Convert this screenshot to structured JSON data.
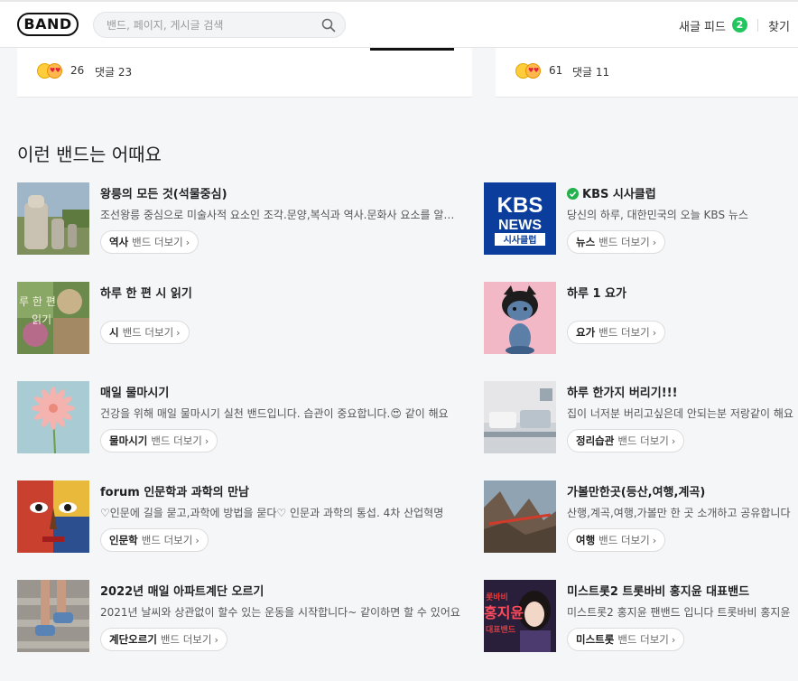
{
  "header": {
    "logo": "BAND",
    "search_placeholder": "밴드, 페이지, 게시글 검색",
    "new_feed_label": "새글 피드",
    "new_feed_count": "2",
    "find_label": "찾기"
  },
  "feed_cards": [
    {
      "reaction_count": "26",
      "comment_label": "댓글 23"
    },
    {
      "reaction_count": "61",
      "comment_label": "댓글 11"
    }
  ],
  "recommend": {
    "title": "이런 밴드는 어때요",
    "more_label": "밴드 더보기",
    "items": [
      {
        "name": "왕릉의 모든 것(석물중심)",
        "desc": "조선왕릉 중심으로 미술사적 요소인 조각.문양,복식과 역사.문화사 요소를 알아봅니다",
        "tag": "역사",
        "thumb": "stone-statue"
      },
      {
        "name": "KBS 시사클럽",
        "verified": true,
        "desc": "당신의 하루, 대한민국의 오늘 KBS 뉴스",
        "tag": "뉴스",
        "thumb": "kbs-logo",
        "thumb_text": [
          "KBS",
          "NEWS",
          "시사클럽"
        ]
      },
      {
        "name": "하루 한 편 시 읽기",
        "desc": "",
        "tag": "시",
        "thumb": "painting-poem",
        "thumb_text": [
          "루 한 편",
          "읽기"
        ]
      },
      {
        "name": "하루 1 요가",
        "desc": "",
        "tag": "요가",
        "thumb": "cartoon-cat"
      },
      {
        "name": "매일 물마시기",
        "desc": "건강을 위해 매일 물마시기 실천 밴드입니다. 습관이 중요합니다.😍 같이 해요",
        "tag": "물마시기",
        "thumb": "pink-flower"
      },
      {
        "name": "하루 한가지 버리기!!!",
        "desc": "집이 너저분 버리고싶은데 안되는분 저랑같이 해요",
        "tag": "정리습관",
        "thumb": "bedroom"
      },
      {
        "name": "forum 인문학과 과학의 만남",
        "desc": "♡인문에 길을 묻고,과학에 방법을 묻다♡ 인문과 과학의 통섭. 4차 산업혁명",
        "tag": "인문학",
        "thumb": "picasso-face"
      },
      {
        "name": "가볼만한곳(등산,여행,계곡)",
        "desc": "산행,계곡,여행,가볼만 한 곳 소개하고 공유합니다",
        "tag": "여행",
        "thumb": "mountain-bridge"
      },
      {
        "name": "2022년 매일 아파트계단 오르기",
        "desc": "2021년 날씨와 상관없이 할수 있는 운동을 시작합니다~ 같이하면 할 수 있어요",
        "tag": "계단오르기",
        "thumb": "stairs-shoes"
      },
      {
        "name": "미스트롯2 트롯바비 홍지윤 대표밴드",
        "desc": "미스트롯2 홍지윤 팬밴드 입니다 트롯바비 홍지윤",
        "tag": "미스트롯",
        "thumb": "singer-portrait",
        "thumb_text": [
          "롯바비",
          "홍지윤",
          "대표밴드"
        ]
      }
    ]
  },
  "colors": {
    "background": "#f5f6f8",
    "badge": "#22c55e",
    "verified": "#22b14c",
    "kbs_blue": "#0a3d9c"
  }
}
